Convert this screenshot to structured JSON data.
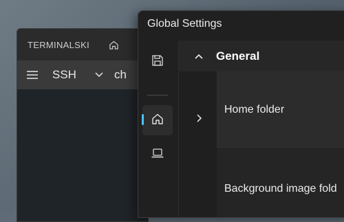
{
  "back_window": {
    "app_title": "TERMINALSKI",
    "toolbar": {
      "protocol_label": "SSH",
      "connection_label": "ch"
    }
  },
  "settings_window": {
    "title": "Global Settings",
    "nav": [
      {
        "icon": "save-icon"
      },
      {
        "icon": "home-icon",
        "selected": true
      },
      {
        "icon": "laptop-icon"
      }
    ],
    "section": {
      "title": "General",
      "expanded": true
    },
    "rows": [
      {
        "label": "Home folder",
        "icon": "chevron-right-icon"
      },
      {
        "label": "Background image fold"
      }
    ]
  },
  "colors": {
    "accent": "#4cc2ff",
    "window_bg": "#202020",
    "row_highlight": "#2c2c2c"
  }
}
